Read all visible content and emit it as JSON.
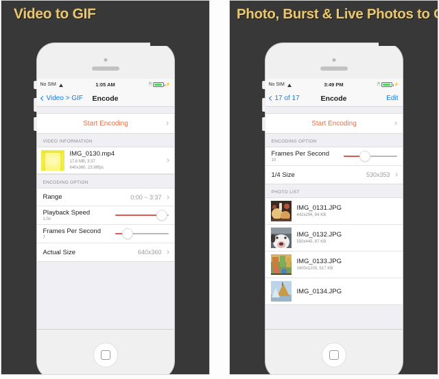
{
  "colors": {
    "panel_bg": "#383838",
    "banner_text": "#e8c774",
    "ios_blue": "#0a7bf5",
    "accent_orange": "#e8714a",
    "slider_red": "#e0574f",
    "battery_green": "#4cd560",
    "screen_bg": "#efeff4"
  },
  "panels": [
    {
      "banner": "Video to GIF",
      "statusbar": {
        "carrier": "No SIM",
        "wifi_icon": "wifi-icon",
        "time": "1:05 AM",
        "bluetooth_icon": "bluetooth-icon",
        "battery_icon": "battery-icon",
        "charging_icon": "plug-icon"
      },
      "navbar": {
        "back_icon": "chevron-left-icon",
        "back_label": "Video > GIF",
        "title": "Encode",
        "right_label": ""
      },
      "action": {
        "label": "Start Encoding",
        "chevron_icon": "chevron-right-icon"
      },
      "sections": [
        {
          "header": "VIDEO INFORMATION",
          "type": "media",
          "items": [
            {
              "thumb": "video-thumbnail",
              "name": "IMG_0130.mp4",
              "meta1": "17.8 MB, 3:37",
              "meta2": "640x360, 23.98fps",
              "chevron_icon": "chevron-right-icon"
            }
          ]
        },
        {
          "header": "ENCODING OPTION",
          "type": "options",
          "rows": [
            {
              "kind": "value",
              "label": "Range",
              "value": "0:00 ~ 3:37",
              "chevron_icon": "chevron-right-icon"
            },
            {
              "kind": "slider",
              "label": "Playback Speed",
              "sub": "1.0x",
              "fill_pct": 88
            },
            {
              "kind": "slider",
              "label": "Frames Per Second",
              "sub": "7",
              "fill_pct": 24
            },
            {
              "kind": "value",
              "label": "Actual Size",
              "value": "640x360",
              "chevron_icon": "chevron-right-icon"
            }
          ]
        }
      ],
      "home_button": "home-button"
    },
    {
      "banner": "Photo, Burst & Live Photos to GIF",
      "statusbar": {
        "carrier": "No SIM",
        "wifi_icon": "wifi-icon",
        "time": "3:49 PM",
        "bluetooth_icon": "bluetooth-icon",
        "battery_icon": "battery-icon",
        "charging_icon": "plug-icon"
      },
      "navbar": {
        "back_icon": "chevron-left-icon",
        "back_label": "17 of 17",
        "title": "Encode",
        "right_label": "Edit"
      },
      "action": {
        "label": "Start Encoding",
        "chevron_icon": "chevron-right-icon"
      },
      "sections": [
        {
          "header": "ENCODING OPTION",
          "type": "options",
          "rows": [
            {
              "kind": "slider",
              "label": "Frames Per Second",
              "sub": "10",
              "fill_pct": 40
            },
            {
              "kind": "value",
              "label": "1/4 Size",
              "value": "530x353",
              "chevron_icon": "chevron-right-icon"
            }
          ]
        },
        {
          "header": "PHOTO LIST",
          "type": "photos",
          "items": [
            {
              "thumb": "photo-thumbnail-food",
              "name": "IMG_0131.JPG",
              "meta1": "442x294, 84 KB"
            },
            {
              "thumb": "photo-thumbnail-dog",
              "name": "IMG_0132.JPG",
              "meta1": "550x445, 87 KB"
            },
            {
              "thumb": "photo-thumbnail-street",
              "name": "IMG_0133.JPG",
              "meta1": "1600x1200, 517 KB"
            },
            {
              "thumb": "photo-thumbnail-temple",
              "name": "IMG_0134.JPG",
              "meta1": ""
            }
          ]
        }
      ],
      "home_button": "home-button"
    }
  ]
}
